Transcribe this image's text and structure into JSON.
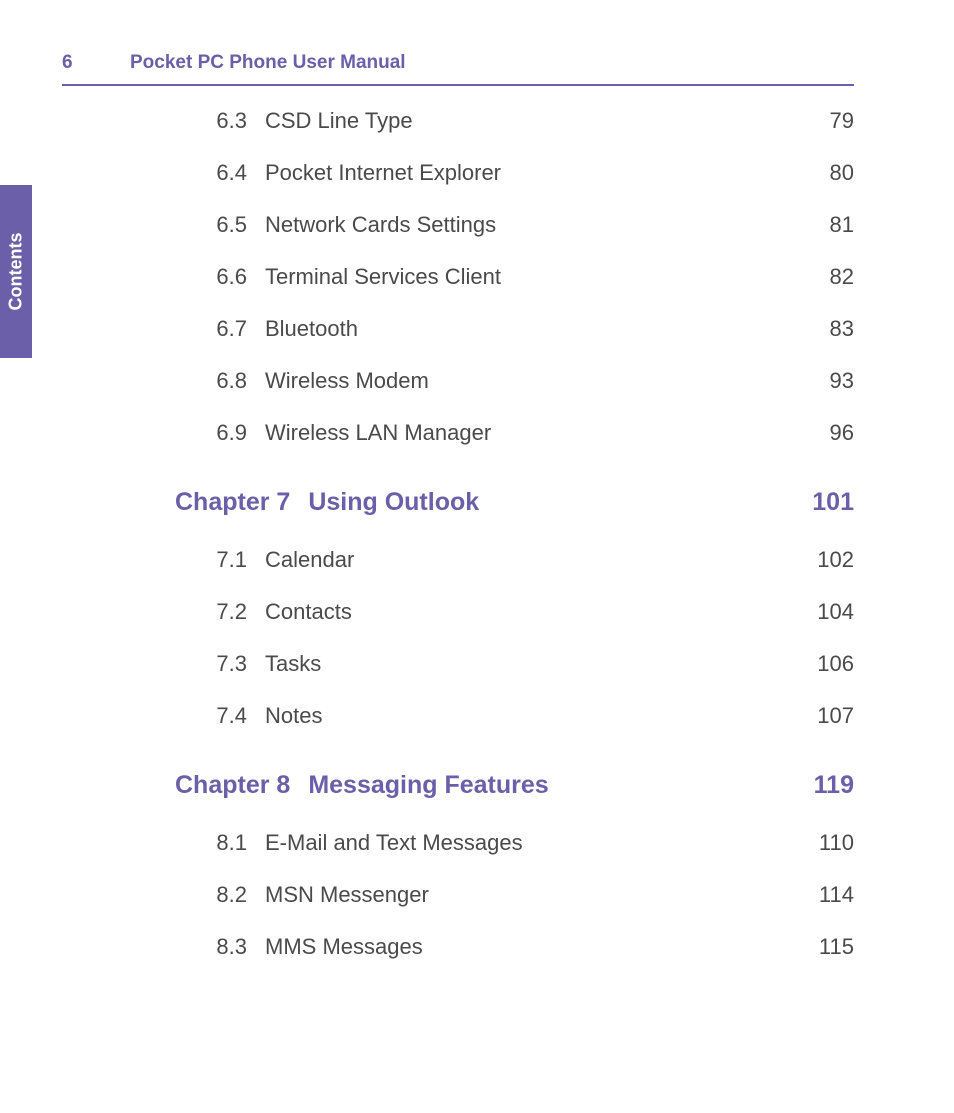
{
  "header": {
    "page_number": "6",
    "doc_title": "Pocket PC Phone User Manual"
  },
  "side_tab": {
    "label": "Contents"
  },
  "toc": {
    "pre_sections": [
      {
        "num": "6.3",
        "title": "CSD Line Type",
        "page": "79"
      },
      {
        "num": "6.4",
        "title": "Pocket Internet Explorer",
        "page": "80"
      },
      {
        "num": "6.5",
        "title": "Network Cards Settings",
        "page": "81"
      },
      {
        "num": "6.6",
        "title": "Terminal Services Client",
        "page": "82"
      },
      {
        "num": "6.7",
        "title": "Bluetooth",
        "page": "83"
      },
      {
        "num": "6.8",
        "title": "Wireless Modem",
        "page": "93"
      },
      {
        "num": "6.9",
        "title": "Wireless LAN Manager",
        "page": "96"
      }
    ],
    "chapters": [
      {
        "label": "Chapter 7",
        "title": "Using Outlook",
        "page": "101",
        "sections": [
          {
            "num": "7.1",
            "title": "Calendar",
            "page": "102"
          },
          {
            "num": "7.2",
            "title": "Contacts",
            "page": "104"
          },
          {
            "num": "7.3",
            "title": "Tasks",
            "page": "106"
          },
          {
            "num": "7.4",
            "title": "Notes",
            "page": "107"
          }
        ]
      },
      {
        "label": "Chapter 8",
        "title": "Messaging Features",
        "page": "119",
        "sections": [
          {
            "num": "8.1",
            "title": "E-Mail and Text Messages",
            "page": "110"
          },
          {
            "num": "8.2",
            "title": "MSN Messenger",
            "page": "114"
          },
          {
            "num": "8.3",
            "title": "MMS Messages",
            "page": "115"
          }
        ]
      }
    ]
  }
}
